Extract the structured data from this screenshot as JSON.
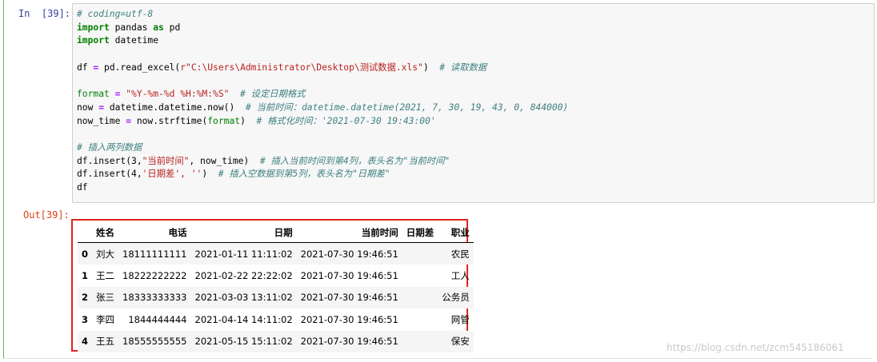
{
  "input_prompt": "In  [39]:",
  "output_prompt": "Out[39]:",
  "code": {
    "l1_comment": "# coding=utf-8",
    "l2_kw": "import",
    "l2_rest": " pandas ",
    "l2_as": "as",
    "l2_alias": " pd",
    "l3_kw": "import",
    "l3_rest": " datetime",
    "l5_a": "df ",
    "l5_eq": "=",
    "l5_b": " pd.read_excel(",
    "l5_str": "r\"C:\\Users\\Administrator\\Desktop\\测试数据.xls\"",
    "l5_c": ")  ",
    "l5_comment": "# 读取数据",
    "l7_fmt": "format",
    "l7_eq": " = ",
    "l7_str": "\"%Y-%m-%d %H:%M:%S\"",
    "l7_comment": "  # 设定日期格式",
    "l8_a": "now ",
    "l8_eq": "=",
    "l8_b": " datetime.datetime.now()  ",
    "l8_comment": "# 当前时间：datetime.datetime(2021, 7, 30, 19, 43, 0, 844000)",
    "l9_a": "now_time ",
    "l9_eq": "=",
    "l9_b": " now.strftime(",
    "l9_fmt": "format",
    "l9_c": ")  ",
    "l9_comment": "# 格式化时间：'2021-07-30 19:43:00'",
    "l11_comment": "# 插入两列数据",
    "l12_a": "df.insert(3,",
    "l12_str": "\"当前时间\"",
    "l12_b": ", now_time)  ",
    "l12_comment": "# 插入当前时间到第4列，表头名为\"当前时间\"",
    "l13_a": "df.insert(4,",
    "l13_str": "'日期差', ''",
    "l13_b": ")  ",
    "l13_comment": "# 插入空数据到第5列，表头名为\"日期差\"",
    "l14": "df"
  },
  "table": {
    "columns": [
      "",
      "姓名",
      "电话",
      "日期",
      "当前时间",
      "日期差",
      "职业"
    ],
    "rows": [
      [
        "0",
        "刘大",
        "18111111111",
        "2021-01-11 11:11:02",
        "2021-07-30 19:46:51",
        "",
        "农民"
      ],
      [
        "1",
        "王二",
        "18222222222",
        "2021-02-22 22:22:02",
        "2021-07-30 19:46:51",
        "",
        "工人"
      ],
      [
        "2",
        "张三",
        "18333333333",
        "2021-03-03 13:11:02",
        "2021-07-30 19:46:51",
        "",
        "公务员"
      ],
      [
        "3",
        "李四",
        "1844444444",
        "2021-04-14 14:11:02",
        "2021-07-30 19:46:51",
        "",
        "网管"
      ],
      [
        "4",
        "王五",
        "18555555555",
        "2021-05-15 15:11:02",
        "2021-07-30 19:46:51",
        "",
        "保安"
      ]
    ]
  },
  "watermark": "https://blog.csdn.net/zcm545186061",
  "colors": {
    "cell_border": "#63b869",
    "highlight_box": "#e0231e",
    "input_prompt": "#303f9f",
    "output_prompt": "#d84315"
  }
}
